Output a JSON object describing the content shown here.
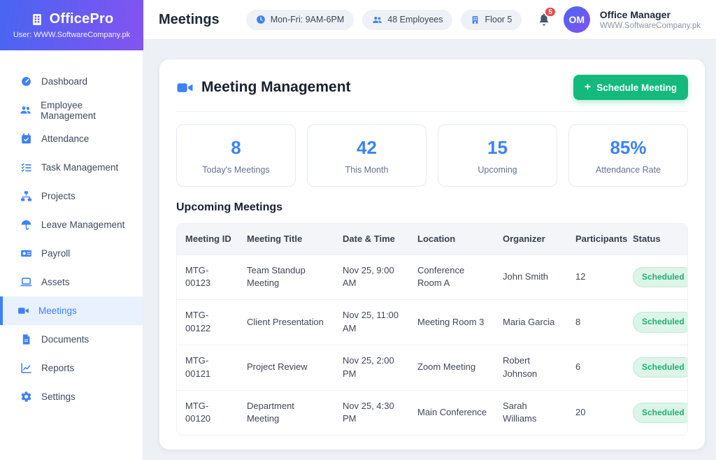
{
  "brand": {
    "name": "OfficePro",
    "user": "User: WWW.SoftwareCompany.pk"
  },
  "header": {
    "title": "Meetings",
    "pills": [
      {
        "icon": "clock-icon",
        "label": "Mon-Fri: 9AM-6PM"
      },
      {
        "icon": "people-icon",
        "label": "48 Employees"
      },
      {
        "icon": "building-icon",
        "label": "Floor 5"
      }
    ],
    "notification_count": "5",
    "avatar_initials": "OM",
    "user_name": "Office Manager",
    "user_org": "WWW.SoftwareCompany.pk"
  },
  "sidebar": {
    "items": [
      {
        "label": "Dashboard"
      },
      {
        "label": "Employee Management"
      },
      {
        "label": "Attendance"
      },
      {
        "label": "Task Management"
      },
      {
        "label": "Projects"
      },
      {
        "label": "Leave Management"
      },
      {
        "label": "Payroll"
      },
      {
        "label": "Assets"
      },
      {
        "label": "Meetings",
        "active": true
      },
      {
        "label": "Documents"
      },
      {
        "label": "Reports"
      },
      {
        "label": "Settings"
      }
    ]
  },
  "main": {
    "section_title": "Meeting Management",
    "schedule_button": {
      "plus": "+",
      "label": "Schedule Meeting"
    },
    "stats": [
      {
        "value": "8",
        "label": "Today's Meetings"
      },
      {
        "value": "42",
        "label": "This Month"
      },
      {
        "value": "15",
        "label": "Upcoming"
      },
      {
        "value": "85%",
        "label": "Attendance Rate"
      }
    ],
    "table_title": "Upcoming Meetings",
    "table": {
      "columns": [
        "Meeting ID",
        "Meeting Title",
        "Date & Time",
        "Location",
        "Organizer",
        "Participants",
        "Status"
      ],
      "rows": [
        {
          "id": "MTG-00123",
          "title": "Team Standup Meeting",
          "datetime": "Nov 25, 9:00 AM",
          "location": "Conference Room A",
          "organizer": "John Smith",
          "participants": "12",
          "status": "Scheduled"
        },
        {
          "id": "MTG-00122",
          "title": "Client Presentation",
          "datetime": "Nov 25, 11:00 AM",
          "location": "Meeting Room 3",
          "organizer": "Maria Garcia",
          "participants": "8",
          "status": "Scheduled"
        },
        {
          "id": "MTG-00121",
          "title": "Project Review",
          "datetime": "Nov 25, 2:00 PM",
          "location": "Zoom Meeting",
          "organizer": "Robert Johnson",
          "participants": "6",
          "status": "Scheduled"
        },
        {
          "id": "MTG-00120",
          "title": "Department Meeting",
          "datetime": "Nov 25, 4:30 PM",
          "location": "Main Conference",
          "organizer": "Sarah Williams",
          "participants": "20",
          "status": "Scheduled"
        }
      ]
    }
  },
  "colors": {
    "accent": "#3b82f6",
    "green": "#13b97d",
    "danger": "#e94b4b",
    "badge_bg": "#dcf5e8",
    "badge_text": "#1fae74",
    "badge_border": "#bfe9d4",
    "banner_from": "#4965f2",
    "banner_to": "#8453f1",
    "page_bg": "#edf0f4"
  }
}
